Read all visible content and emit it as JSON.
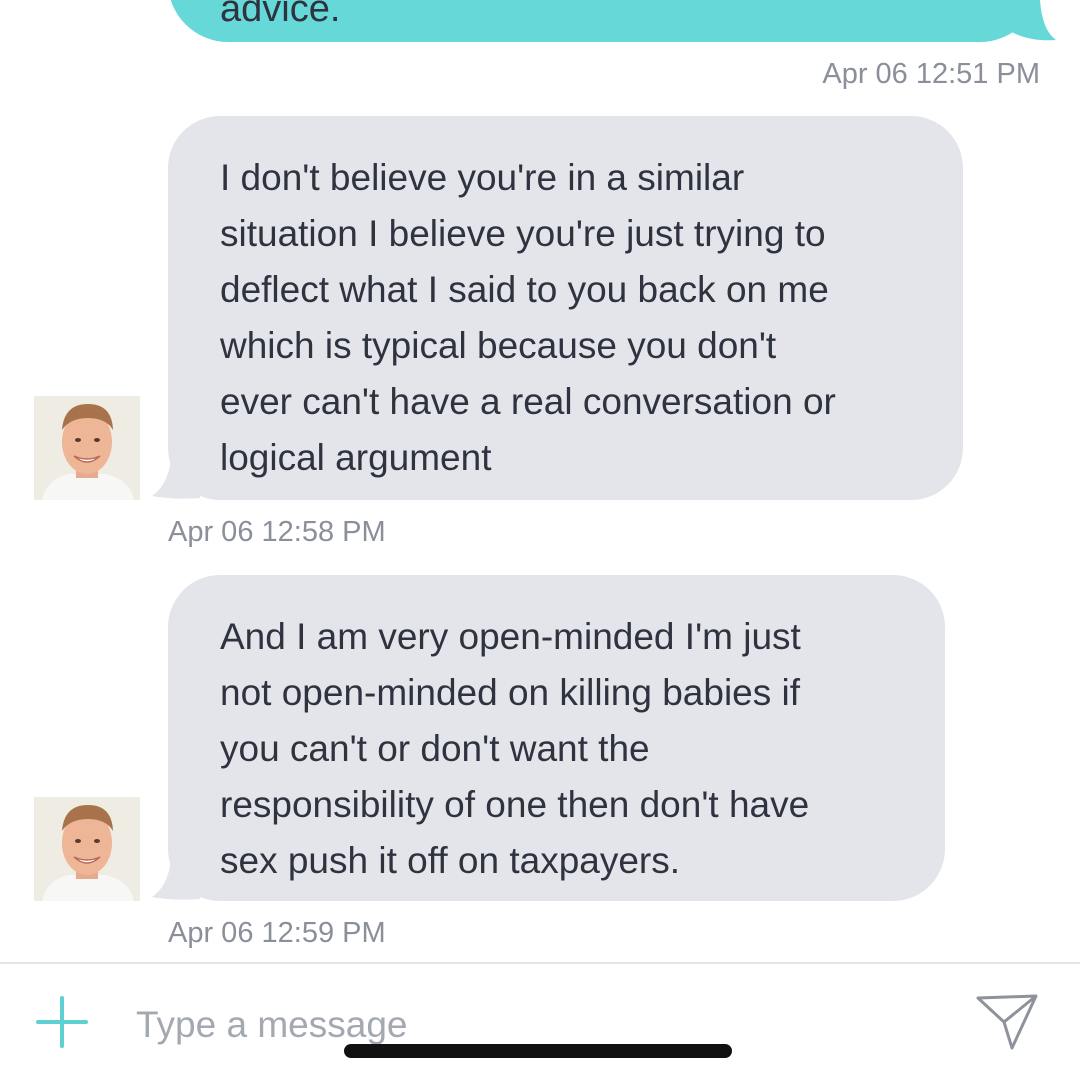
{
  "conversation": {
    "outgoing_partial": {
      "text": "advice.",
      "timestamp": "Apr 06 12:51 PM"
    },
    "messages": [
      {
        "lines": [
          "I don't believe you're in a similar",
          "situation I believe you're just trying to",
          "deflect what I said to you back on me",
          "which is typical because you don't",
          "ever can't have a real conversation or",
          "logical argument"
        ],
        "timestamp": "Apr 06 12:58 PM"
      },
      {
        "lines": [
          "And I am very open-minded I'm just",
          "not open-minded on killing babies if",
          "you can't or don't want the",
          "responsibility of one then don't have",
          "sex push it off on taxpayers."
        ],
        "timestamp": "Apr 06 12:59 PM"
      }
    ]
  },
  "composer": {
    "placeholder": "Type a message",
    "value": ""
  },
  "icons": {
    "add": "plus-icon",
    "send": "send-icon",
    "avatar": "avatar-photo"
  },
  "colors": {
    "outgoing_bubble": "#66d8d8",
    "incoming_bubble": "#e3e5ea",
    "accent": "#5fd0d2",
    "timestamp": "#8a8f99"
  }
}
